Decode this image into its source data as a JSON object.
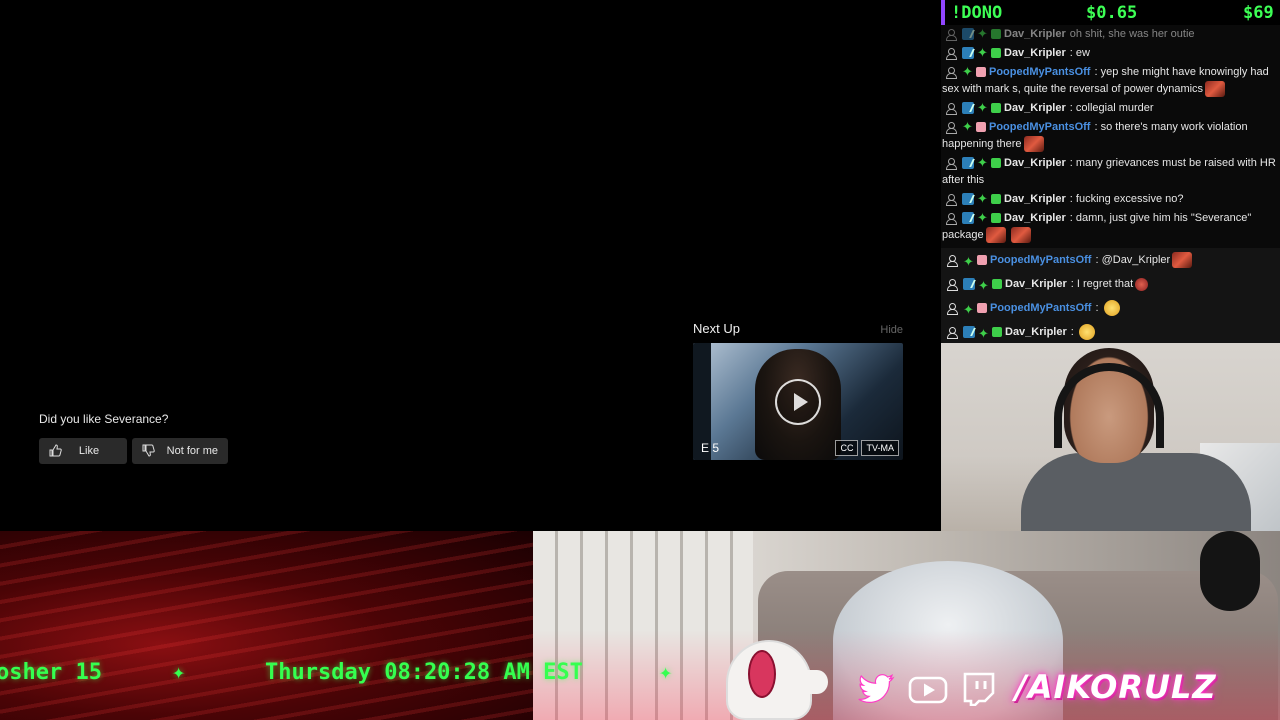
{
  "player": {
    "rating": {
      "question": "Did you like Severance?",
      "like_label": "Like",
      "dislike_label": "Not for me"
    },
    "next_up": {
      "heading": "Next Up",
      "hide_label": "Hide",
      "episode": "E 5",
      "badges": [
        "CC",
        "TV-MA"
      ]
    }
  },
  "overlay": {
    "dono_label": "!DONO",
    "dono_amount": "$0.65",
    "dono_goal": "$69",
    "ticker": {
      "date": "osher 15",
      "separator": "✦",
      "time": "Thursday 08:20:28 AM EST"
    },
    "handle": "/AIKORULZ",
    "social_icons": [
      "twitter-icon",
      "youtube-icon",
      "twitch-icon"
    ]
  },
  "chat": {
    "messages": [
      {
        "user": "Dav_Kripler",
        "text": "oh shit, she was her outie",
        "dim": true
      },
      {
        "user": "Dav_Kripler",
        "text": "ew"
      },
      {
        "user": "PoopedMyPantsOff",
        "text": "yep she might have knowingly had sex with mark s, quite the reversal of power dynamics"
      },
      {
        "user": "Dav_Kripler",
        "text": "collegial murder"
      },
      {
        "user": "PoopedMyPantsOff",
        "text": "so there's many work violation happening there"
      },
      {
        "user": "Dav_Kripler",
        "text": "many grievances must be raised with HR after this"
      },
      {
        "user": "Dav_Kripler",
        "text": "fucking excessive no?"
      },
      {
        "user": "Dav_Kripler",
        "text": "damn, just give him his \"Severance\" package"
      },
      {
        "user": "PoopedMyPantsOff",
        "text": "@Dav_Kripler"
      },
      {
        "user": "Dav_Kripler",
        "text": "I regret that"
      },
      {
        "user": "PoopedMyPantsOff",
        "text": ""
      },
      {
        "user": "Dav_Kripler",
        "text": ""
      }
    ]
  },
  "colors": {
    "accent_green": "#35ff4f",
    "chat_blue": "#4a90e2",
    "twitch_purple": "#9146ff",
    "handle_pink": "#ff3cc8"
  }
}
